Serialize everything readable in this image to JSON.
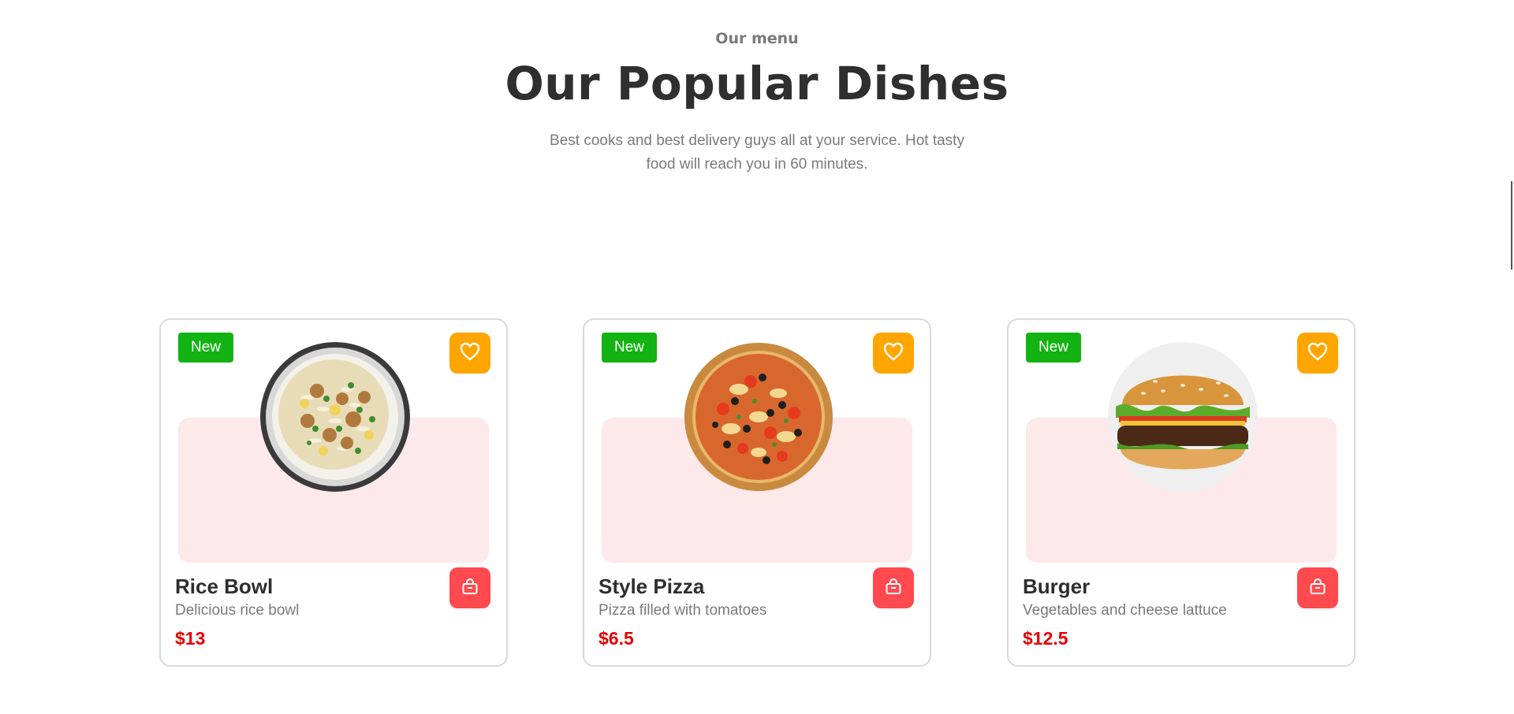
{
  "section": {
    "eyebrow": "Our menu",
    "title": "Our Popular Dishes",
    "subtitle": "Best cooks and best delivery guys all at your service. Hot tasty food will reach you in 60 minutes."
  },
  "colors": {
    "badge_green": "#12b312",
    "favorite_orange": "#ffa500",
    "cart_red": "#ff4a4f",
    "price_red": "#e60000",
    "panel_pink": "#fde8ea"
  },
  "dishes": [
    {
      "badge": "New",
      "name": "Rice Bowl",
      "description": "Delicious rice bowl",
      "price": "$13",
      "image": "rice-bowl-image",
      "favorite_icon": "heart-icon",
      "cart_icon": "shopping-bag-icon"
    },
    {
      "badge": "New",
      "name": "Style Pizza",
      "description": "Pizza filled with tomatoes",
      "price": "$6.5",
      "image": "pizza-image",
      "favorite_icon": "heart-icon",
      "cart_icon": "shopping-bag-icon"
    },
    {
      "badge": "New",
      "name": "Burger",
      "description": "Vegetables and cheese lattuce",
      "price": "$12.5",
      "image": "burger-image",
      "favorite_icon": "heart-icon",
      "cart_icon": "shopping-bag-icon"
    }
  ]
}
